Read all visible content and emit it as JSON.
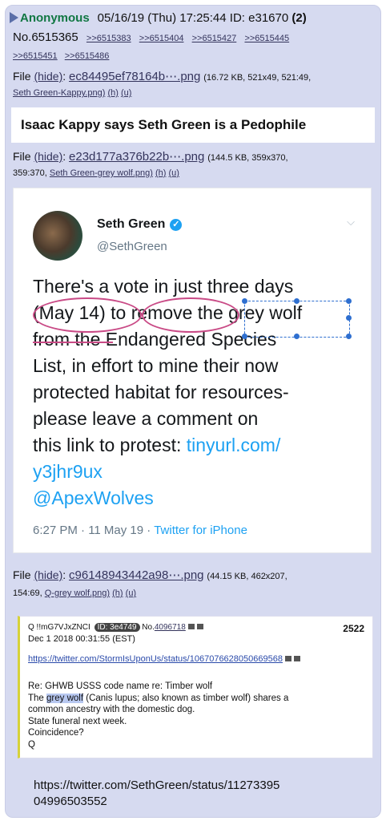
{
  "header": {
    "name": "Anonymous",
    "date": "05/16/19 (Thu) 17:25:44",
    "id_label": "ID: e31670",
    "reply_count": "(2)",
    "post_no": "No.6515365",
    "replies_line1": [
      ">>6515383",
      ">>6515404",
      ">>6515427",
      ">>6515445"
    ],
    "replies_line2": [
      ">>6515451",
      ">>6515486"
    ]
  },
  "file1": {
    "label": "File",
    "hide": "(hide)",
    "name": "ec84495ef78164b⋯.png",
    "meta": "(16.72 KB, 521x49, 521:49,",
    "orig": "Seth Green-Kappy.png)",
    "h": "(h)",
    "u": "(u)"
  },
  "headline": "Isaac Kappy says Seth Green is a Pedophile",
  "file2": {
    "label": "File",
    "hide": "(hide)",
    "name": "e23d177a376b22b⋯.png",
    "meta": "(144.5 KB, 359x370,",
    "meta2": "359:370,",
    "orig": "Seth Green-grey wolf.png)",
    "h": "(h)",
    "u": "(u)"
  },
  "tweet": {
    "name": "Seth Green",
    "verified_icon": "✓",
    "handle": "@SethGreen",
    "chevron": "⌵",
    "lines": [
      "There's a vote in just three days",
      "(May 14) to remove the grey wolf",
      "from the Endangered Species",
      "List, in effort to mine their now",
      "protected habitat for resources-",
      "please leave a comment on",
      "this link to protest: "
    ],
    "link1": "tinyurl.com/",
    "link2": "y3jhr9ux",
    "link3": "@ApexWolves",
    "time": "6:27 PM · 11 May 19 · ",
    "client": "Twitter for iPhone"
  },
  "file3": {
    "label": "File",
    "hide": "(hide)",
    "name": "c96148943442a98⋯.png",
    "meta": "(44.15 KB, 462x207,",
    "meta2": "154:69,",
    "orig": "Q-grey wolf.png)",
    "h": "(h)",
    "u": "(u)"
  },
  "qpost": {
    "trip": "Q !!mG7VJxZNCI",
    "id": "ID: 3e4749",
    "no": "No.",
    "no_link": "4096718",
    "number": "2522",
    "date": "Dec 1 2018 00:31:55 (EST)",
    "url": "https://twitter.com/StormIsUponUs/status/1067076628050669568",
    "body": [
      "Re: GHWB USSS code name re: Timber wolf",
      "(Canis lupus; also known as timber wolf) shares a",
      "common ancestry with the domestic dog.",
      "State funeral next week.",
      "Coincidence?",
      "Q"
    ],
    "body_pre": "The ",
    "highlight": "grey wolf"
  },
  "footer_url_1": "https://twitter.com/SethGreen/status/11273395",
  "footer_url_2": "04996503552"
}
